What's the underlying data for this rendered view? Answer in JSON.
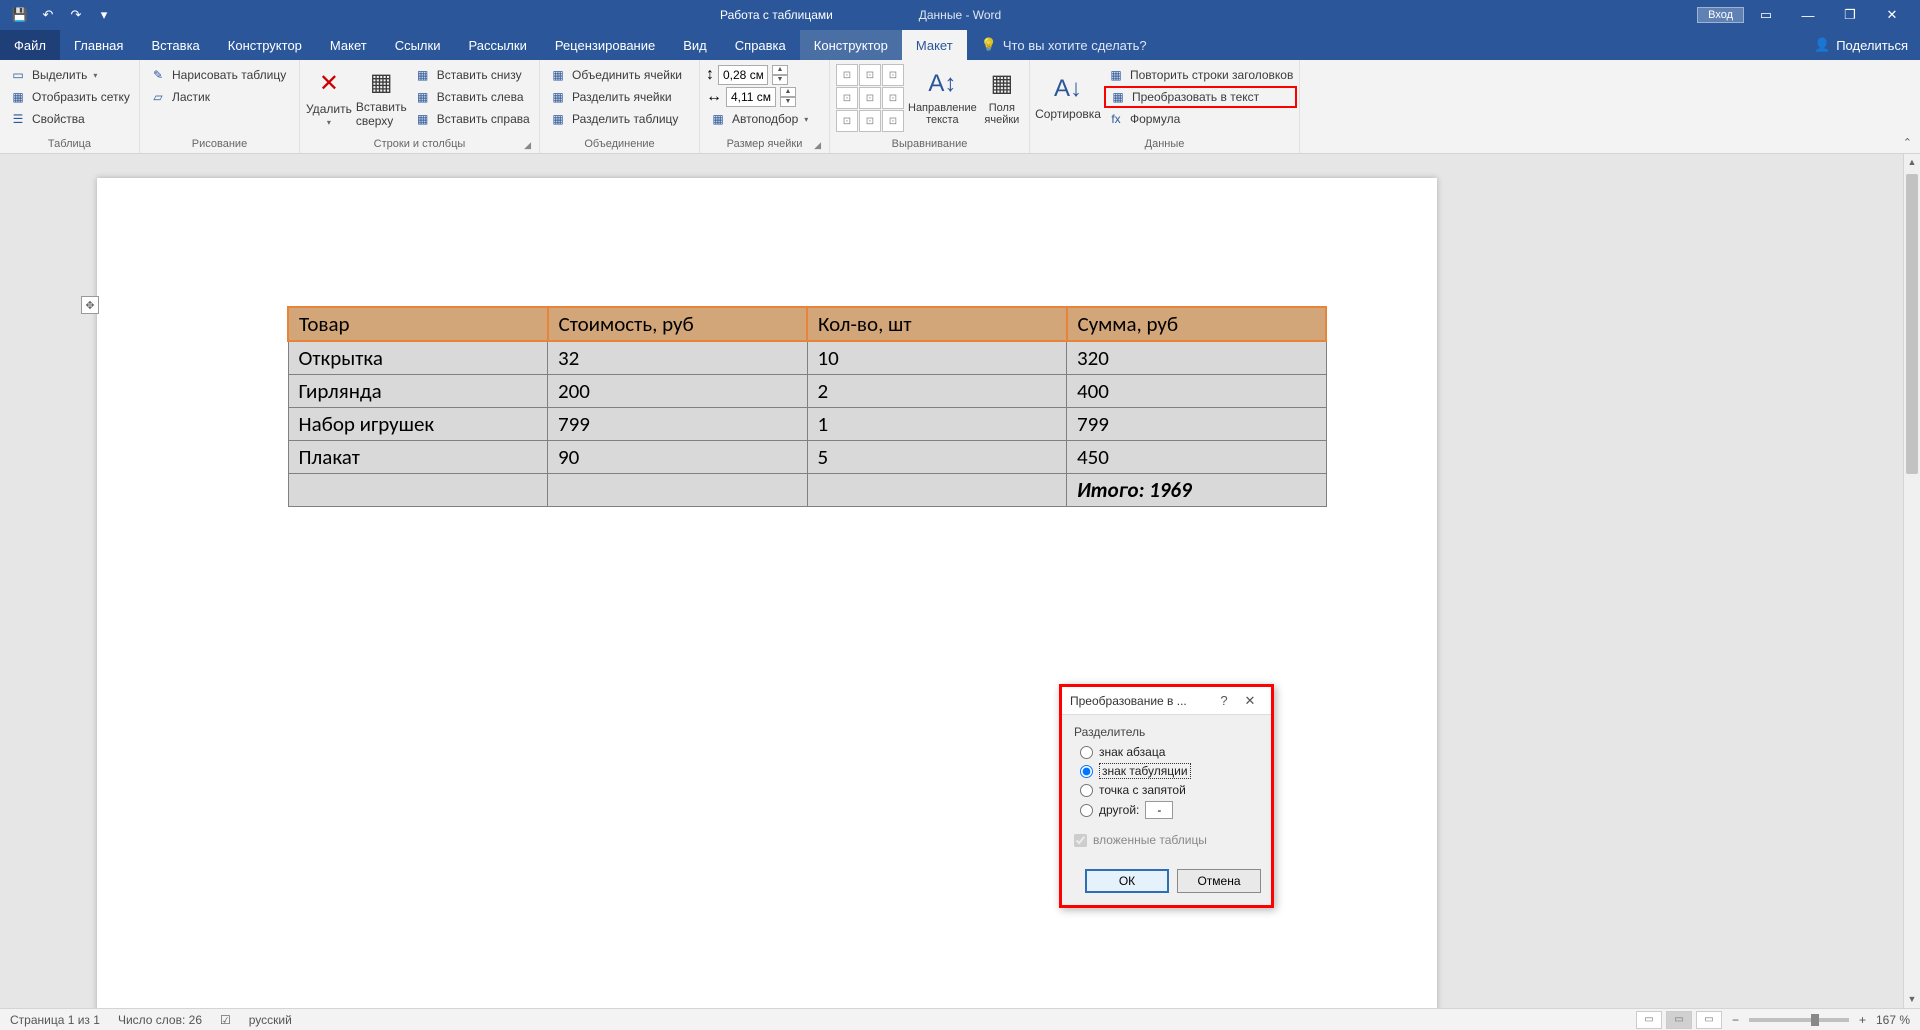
{
  "titlebar": {
    "doc_title": "Данные - Word",
    "table_tools": "Работа с таблицами",
    "login": "Вход"
  },
  "tabs": {
    "file": "Файл",
    "items": [
      "Главная",
      "Вставка",
      "Конструктор",
      "Макет",
      "Ссылки",
      "Рассылки",
      "Рецензирование",
      "Вид",
      "Справка"
    ],
    "ctx_design": "Конструктор",
    "ctx_layout": "Макет",
    "tellme": "Что вы хотите сделать?",
    "share": "Поделиться"
  },
  "ribbon": {
    "table_group": {
      "select": "Выделить",
      "gridlines": "Отобразить сетку",
      "properties": "Свойства",
      "label": "Таблица"
    },
    "draw_group": {
      "draw": "Нарисовать таблицу",
      "eraser": "Ластик",
      "label": "Рисование"
    },
    "rows_cols_group": {
      "delete": "Удалить",
      "insert_above": "Вставить сверху",
      "insert_below": "Вставить снизу",
      "insert_left": "Вставить слева",
      "insert_right": "Вставить справа",
      "label": "Строки и столбцы"
    },
    "merge_group": {
      "merge": "Объединить ячейки",
      "split_cells": "Разделить ячейки",
      "split_table": "Разделить таблицу",
      "label": "Объединение"
    },
    "cell_size_group": {
      "height": "0,28 см",
      "width": "4,11 см",
      "autofit": "Автоподбор",
      "label": "Размер ячейки"
    },
    "alignment_group": {
      "text_direction": "Направление текста",
      "cell_margins": "Поля ячейки",
      "label": "Выравнивание"
    },
    "data_group": {
      "sort": "Сортировка",
      "repeat_header": "Повторить строки заголовков",
      "convert_to_text": "Преобразовать в текст",
      "formula": "Формула",
      "label": "Данные"
    }
  },
  "table": {
    "headers": [
      "Товар",
      "Стоимость, руб",
      "Кол-во, шт",
      "Сумма, руб"
    ],
    "rows": [
      [
        "Открытка",
        "32",
        "10",
        "320"
      ],
      [
        "Гирлянда",
        "200",
        "2",
        "400"
      ],
      [
        "Набор игрушек",
        "799",
        "1",
        "799"
      ],
      [
        "Плакат",
        "90",
        "5",
        "450"
      ]
    ],
    "total": "Итого: 1969"
  },
  "dialog": {
    "title": "Преобразование в ...",
    "separator_label": "Разделитель",
    "opt_paragraph": "знак абзаца",
    "opt_tab": "знак табуляции",
    "opt_semicolon": "точка с запятой",
    "opt_other": "другой:",
    "other_value": "-",
    "nested": "вложенные таблицы",
    "ok": "ОК",
    "cancel": "Отмена"
  },
  "statusbar": {
    "page": "Страница 1 из 1",
    "words": "Число слов: 26",
    "lang": "русский",
    "zoom": "167 %"
  }
}
